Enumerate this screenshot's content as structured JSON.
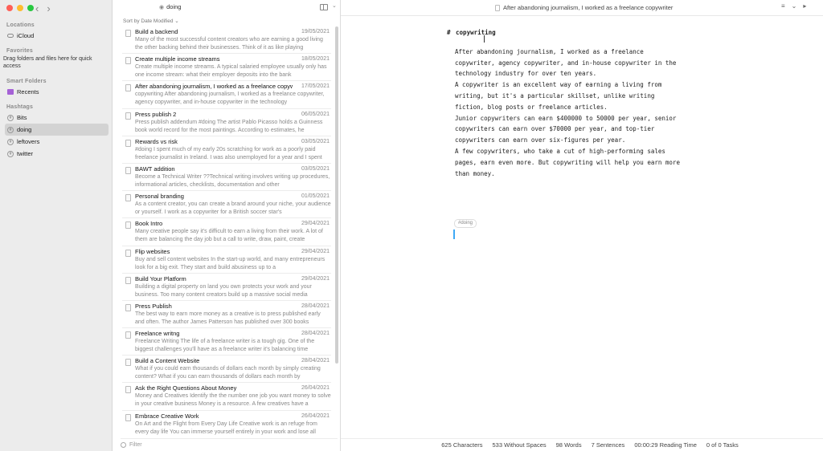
{
  "sidebar": {
    "sections": {
      "locations": "Locations",
      "favorites": "Favorites",
      "smart_folders": "Smart Folders",
      "hashtags": "Hashtags"
    },
    "icloud": "iCloud",
    "favorites_hint": "Drag folders and files here for quick access",
    "recents": "Recents",
    "tags": [
      "Bits",
      "doing",
      "leftovers",
      "twitter"
    ],
    "active_tag": "doing"
  },
  "list": {
    "search_tag": "doing",
    "sort_label": "Sort by Date Modified ⌄",
    "filter_placeholder": "Filter",
    "notes": [
      {
        "title": "Build a backend",
        "date": "19/05/2021",
        "excerpt": "Many of the most successful content creators who are earning a good living the other backing behind their businesses. Think of it as like playing"
      },
      {
        "title": "Create multiple income streams",
        "date": "18/05/2021",
        "excerpt": "Create multiple income streams. A typical salaried employee usually only has one income stream: what their employer deposits into the bank"
      },
      {
        "title": "After abandoning journalism, I worked as a freelance copywrit...",
        "date": "17/05/2021",
        "excerpt": "copywriting After abandoning journalism, I worked as a freelance copywriter, agency copywriter, and in-house copywriter in the technology"
      },
      {
        "title": "Press publish 2",
        "date": "06/05/2021",
        "excerpt": "Press publish addendum #doing The artist Pablo Picasso holds a Guinness book world record for the most paintings. According to estimates, he"
      },
      {
        "title": "Rewards vs risk",
        "date": "03/05/2021",
        "excerpt": "#doing I spent much of my early 20s scratching for work as a poorly paid freelance journalist in Ireland. I was also unemployed for a year and I spent"
      },
      {
        "title": "BAWT addition",
        "date": "03/05/2021",
        "excerpt": "Become a Technical Writer ??Technical writing involves writing up procedures, informational articles, checklists, documentation and other"
      },
      {
        "title": "Personal branding",
        "date": "01/05/2021",
        "excerpt": "As a content creator, you can create a brand around your niche, your audience or yourself. I work as a copywriter for a British soccer star's"
      },
      {
        "title": "Book Intro",
        "date": "29/04/2021",
        "excerpt": "Many creative people say it's difficult to earn a living from their work. A lot of them are balancing the day job but a call to write, draw, paint, create"
      },
      {
        "title": "Flip websites",
        "date": "29/04/2021",
        "excerpt": "Buy and sell content websites In the start-up world, and many entrepreneurs look for a big exit. They start and build abusiness up to a"
      },
      {
        "title": "Build Your Platform",
        "date": "29/04/2021",
        "excerpt": "Building a digital property on land you own protects your work and your business. Too many content creators build up a massive social media"
      },
      {
        "title": "Press Publish",
        "date": "28/04/2021",
        "excerpt": "The best way to earn more money as a creative is to press published early and often. The author James Patterson has published over 300 books"
      },
      {
        "title": "Freelance writng",
        "date": "28/04/2021",
        "excerpt": "Freelance Writing The life of a freelance writer is a tough gig. One of the biggest challenges you'll have as a freelance writer it's balancing time"
      },
      {
        "title": "Build a Content Website",
        "date": "28/04/2021",
        "excerpt": "What if you could earn thousands of dollars each month by simply creating content? What if you can earn thousands of dollars each month by"
      },
      {
        "title": "Ask the Right Questions About Money",
        "date": "26/04/2021",
        "excerpt": "Money and Creatives Identify the the number one job you want money to solve in your creative business Money is a resource. A few creatives have a"
      },
      {
        "title": "Embrace Creative Work",
        "date": "26/04/2021",
        "excerpt": "On Art and the Flight from Every Day Life Creative work is an refuge from every day life You can immerse yourself entirely in your work and lose all"
      }
    ]
  },
  "editor": {
    "window_title": "After abandoning journalism, I worked as a freelance copywriter",
    "heading_mark": "#",
    "heading": "copywriting",
    "paragraphs": [
      "After abandoning journalism, I worked as a freelance\ncopywriter, agency copywriter, and in-house copywriter in the\ntechnology industry for over ten years.",
      "A copywriter is an excellent way of earning a living from\nwriting, but it's a particular skillset, unlike writing\nfiction, blog posts or freelance articles.",
      "Junior copywriters can earn $400000 to 50000 per year, senior\ncopywriters can earn over $70000 per year, and top-tier\ncopywriters can earn over six-figures per year.",
      "A few copywriters, who take a cut of high-performing sales\npages, earn even more. But copywriting will help you earn more\nthan money."
    ],
    "tag_chip": "#doing"
  },
  "status": {
    "characters": "625 Characters",
    "without_spaces": "533 Without Spaces",
    "words": "98 Words",
    "sentences": "7 Sentences",
    "reading_time": "00:00:29 Reading Time",
    "tasks": "0 of 0 Tasks"
  },
  "colors": {
    "accent": "#3fa9f5",
    "sidebar_bg": "#ececec",
    "folder": "#a561d6"
  }
}
